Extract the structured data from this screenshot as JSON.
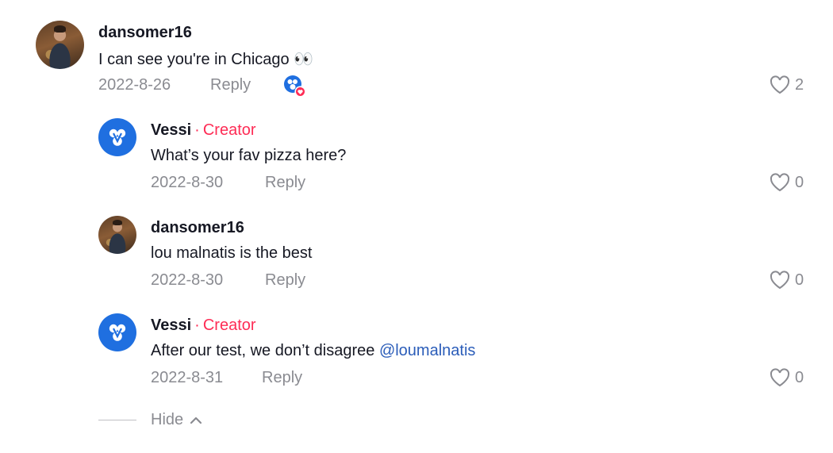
{
  "comments": [
    {
      "username": "dansomer16",
      "text": "I can see you're in Chicago 👀",
      "date": "2022-8-26",
      "reply_label": "Reply",
      "likes": "2"
    },
    {
      "username": "Vessi",
      "badge": "Creator",
      "text": "What’s your fav pizza here?",
      "date": "2022-8-30",
      "reply_label": "Reply",
      "likes": "0"
    },
    {
      "username": "dansomer16",
      "text": "lou malnatis is the best",
      "date": "2022-8-30",
      "reply_label": "Reply",
      "likes": "0"
    },
    {
      "username": "Vessi",
      "badge": "Creator",
      "text": "After our test, we don’t disagree ",
      "mention": "@loumalnatis",
      "date": "2022-8-31",
      "reply_label": "Reply",
      "likes": "0"
    }
  ],
  "hide_label": "Hide",
  "colors": {
    "creator": "#fe2c55",
    "mention": "#2b5db9",
    "meta": "#8a8b91",
    "brand_avatar": "#1f6fe0"
  },
  "icons": [
    "heart-outline-icon",
    "creator-liked-badge-icon",
    "chevron-up-icon",
    "vessi-logo-icon"
  ]
}
